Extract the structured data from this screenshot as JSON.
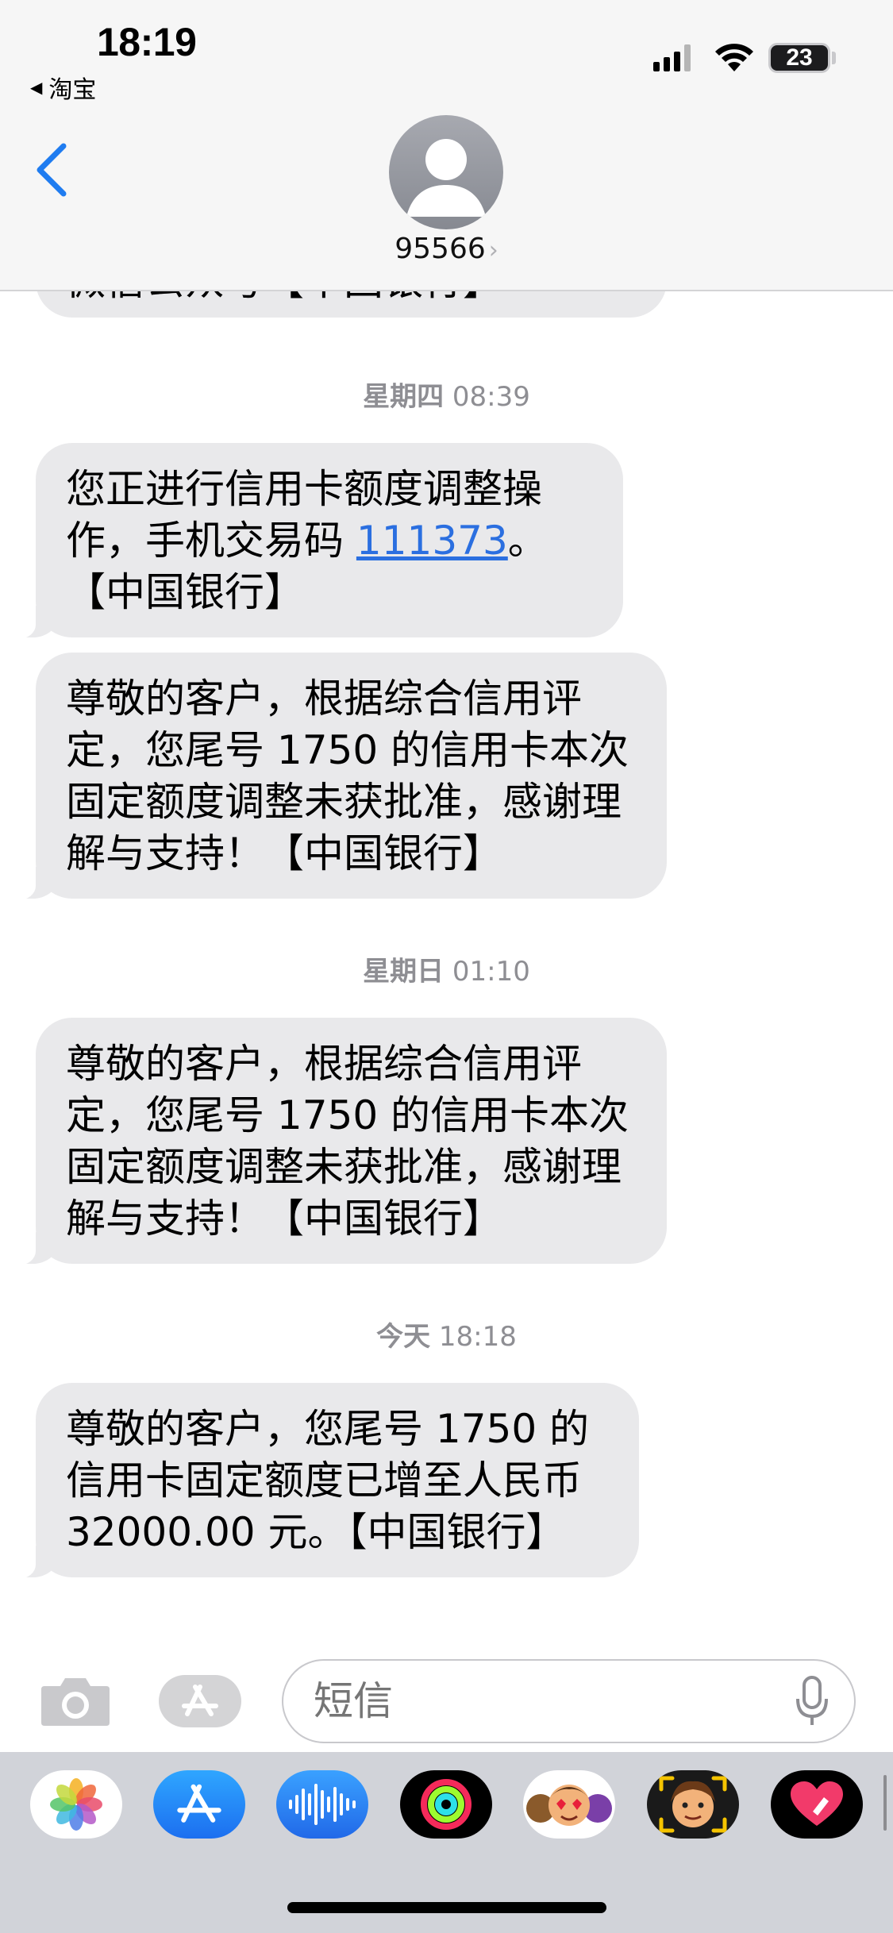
{
  "status_bar": {
    "time": "18:19",
    "back_app": "淘宝",
    "battery": "23"
  },
  "header": {
    "contact": "95566"
  },
  "partial_top_bubble": {
    "text": "微信公众号【中国银行】"
  },
  "messages": [
    {
      "timestamp_day": "星期四",
      "timestamp_time": "08:39"
    },
    {
      "text_before": "您正进行信用卡额度调整操作，手机交易码 ",
      "code": "111373",
      "text_after": "。【中国银行】"
    },
    {
      "text": "尊敬的客户，根据综合信用评定，您尾号 1750 的信用卡本次固定额度调整未获批准，感谢理解与支持！【中国银行】"
    },
    {
      "timestamp_day": "星期日",
      "timestamp_time": "01:10"
    },
    {
      "text": "尊敬的客户，根据综合信用评定，您尾号 1750 的信用卡本次固定额度调整未获批准，感谢理解与支持！【中国银行】"
    },
    {
      "timestamp_day": "今天",
      "timestamp_time": "18:18"
    },
    {
      "text": "尊敬的客户，您尾号 1750 的信用卡固定额度已增至人民币 32000.00 元。【中国银行】"
    }
  ],
  "input": {
    "placeholder": "短信"
  },
  "app_drawer": {
    "apps": [
      "photos-app-icon",
      "app-store-icon",
      "audio-message-icon",
      "fitness-activity-icon",
      "memoji-stickers-icon",
      "memoji-icon",
      "digital-touch-icon"
    ]
  },
  "colors": {
    "bubble_gray": "#e9e9eb",
    "link_blue": "#2b6fe0",
    "ios_blue": "#1f7cf0",
    "timestamp_gray": "#8e8e93"
  }
}
